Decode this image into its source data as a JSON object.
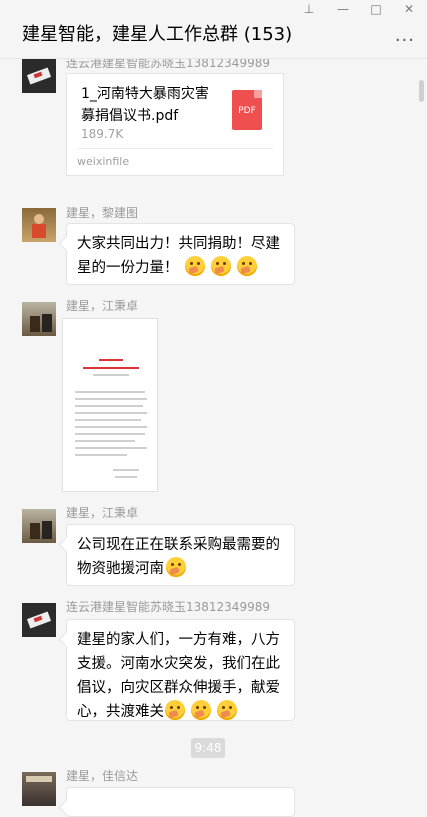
{
  "header": {
    "title": "建星智能，建星人工作总群 (153)",
    "more_glyph": "..."
  },
  "window_controls": {
    "pin": "⊥",
    "minimize": "—",
    "maximize": "□",
    "close": "✕"
  },
  "messages": [
    {
      "sender": "连云港建星智能苏晓玉13812349989",
      "file": {
        "name": "1_河南特大暴雨灾害募捐倡议书.pdf",
        "size": "189.7K",
        "source": "weixinfile",
        "type_label": "PDF"
      }
    },
    {
      "sender": "建星，黎建图",
      "text": "大家共同出力！共同捐助！尽建星的一份力量！"
    },
    {
      "sender": "建星，江秉卓",
      "image": "document"
    },
    {
      "sender": "建星，江秉卓",
      "text": "公司现在正在联系采购最需要的物资驰援河南"
    },
    {
      "sender": "连云港建星智能苏晓玉13812349989",
      "text": "建星的家人们，一方有难，八方支援。河南水灾突发，我们在此倡议，向灾区群众伸援手，献爱心，共渡难关"
    },
    {
      "time": "9:48"
    },
    {
      "sender": "建星，佳信达"
    }
  ],
  "colors": {
    "background": "#f5f5f5",
    "bubble": "#ffffff",
    "pdf": "#f04f4f",
    "sender": "#9a9a9a"
  },
  "icons": {
    "file": "pdf-icon",
    "emoji": "fist-emoji-icon"
  }
}
